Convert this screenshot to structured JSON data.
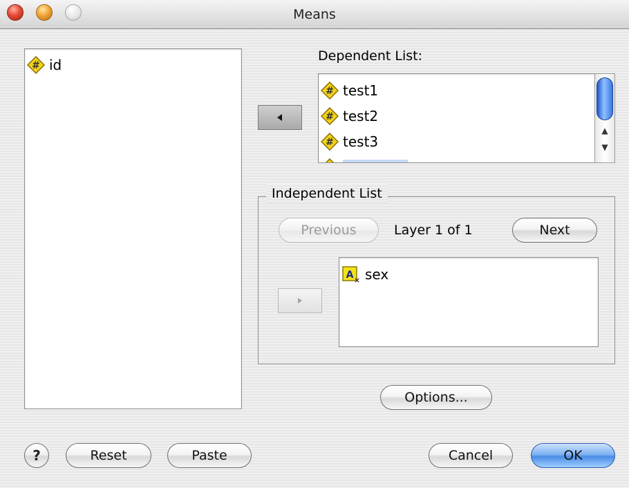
{
  "window": {
    "title": "Means"
  },
  "source_list": {
    "items": [
      {
        "label": "id",
        "type": "numeric"
      }
    ]
  },
  "dependent": {
    "label": "Dependent List:",
    "items": [
      {
        "label": "test1",
        "type": "numeric"
      },
      {
        "label": "test2",
        "type": "numeric"
      },
      {
        "label": "test3",
        "type": "numeric"
      }
    ],
    "move_icon": "triangle-left-icon"
  },
  "independent": {
    "group_title": "Independent List",
    "previous_label": "Previous",
    "next_label": "Next",
    "layer_text": "Layer 1 of 1",
    "items": [
      {
        "label": "sex",
        "type": "string"
      }
    ],
    "move_icon": "triangle-right-icon"
  },
  "buttons": {
    "help": "?",
    "reset": "Reset",
    "paste": "Paste",
    "options": "Options...",
    "cancel": "Cancel",
    "ok": "OK"
  },
  "colors": {
    "numeric_icon": "#f2d21a",
    "string_icon": "#f2e21a",
    "selection": "#c4d9f5",
    "default_button": "#4a8ce6"
  }
}
